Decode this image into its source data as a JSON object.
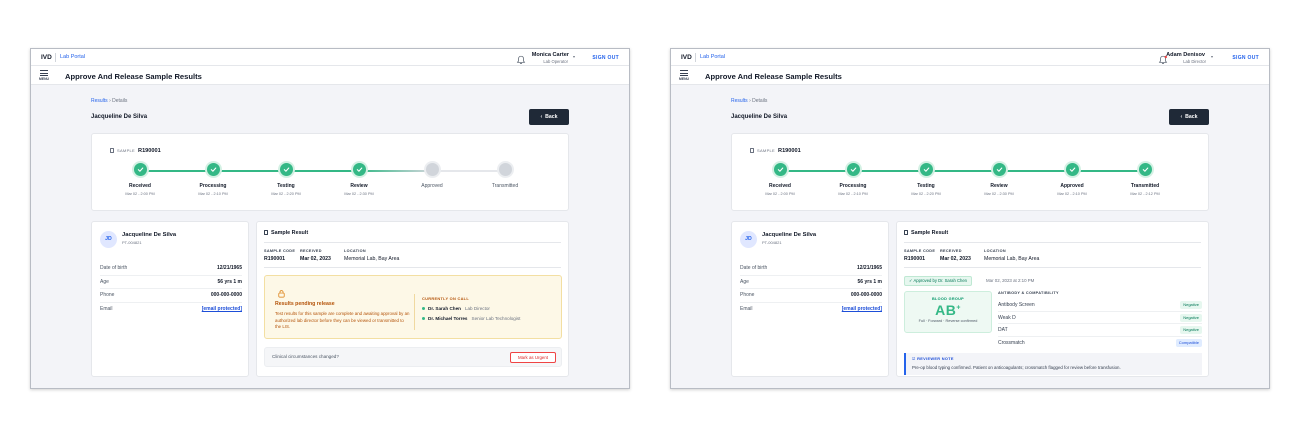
{
  "brand": "IVD",
  "portal": "Lab Portal",
  "sign_out": "SIGN OUT",
  "menu_label": "MENU",
  "page_title": "Approve And Release Sample Results",
  "breadcrumb": {
    "link": "Results",
    "sep": "›",
    "current": "Details"
  },
  "back_label": "Back",
  "patient": {
    "name": "Jacqueline De Silva",
    "initials": "JD",
    "id": "PT-004821",
    "rows": [
      {
        "label": "Date of birth",
        "value": "12/21/1965"
      },
      {
        "label": "Age",
        "value": "56 yrs 1 m"
      },
      {
        "label": "Phone",
        "value": "000-000-0000"
      },
      {
        "label": "Email",
        "value": "[email protected]"
      }
    ]
  },
  "sample": {
    "label": "SAMPLE",
    "code": "R190001"
  },
  "result": {
    "heading": "Sample Result",
    "meta": [
      {
        "label": "SAMPLE CODE",
        "value": "R190001"
      },
      {
        "label": "RECEIVED",
        "value": "Mar 02, 2023"
      },
      {
        "label": "LOCATION",
        "value": "Memorial Lab, Bay Area"
      }
    ]
  },
  "screens": [
    {
      "user": {
        "name": "Monica Carter",
        "role": "Lab Operator"
      },
      "steps": [
        {
          "label": "Received",
          "time": "Mar 02 - 2:00 PM",
          "done": true
        },
        {
          "label": "Processing",
          "time": "Mar 02 - 2:10 PM",
          "done": true
        },
        {
          "label": "Testing",
          "time": "Mar 02 - 2:20 PM",
          "done": true
        },
        {
          "label": "Review",
          "time": "Mar 02 - 2:30 PM",
          "done": true
        },
        {
          "label": "Approved",
          "time": "",
          "done": false
        },
        {
          "label": "Transmitted",
          "time": "",
          "done": false
        }
      ],
      "pending": {
        "title": "Results pending release",
        "text": "Test results for this sample are complete and awaiting approval by an authorized lab director before they can be viewed or transmitted to the LIS.",
        "oncall_label": "CURRENTLY ON CALL",
        "oncall": [
          {
            "name": "Dr. Sarah Chen",
            "role": "Lab Director"
          },
          {
            "name": "Dr. Michael Torres",
            "role": "Senior Lab Technologist"
          }
        ]
      },
      "clinical": {
        "question": "Clinical circumstances changed?",
        "button": "Mark as Urgent"
      }
    },
    {
      "user": {
        "name": "Adam Denisov",
        "role": "Lab Director"
      },
      "steps": [
        {
          "label": "Received",
          "time": "Mar 02 - 2:00 PM",
          "done": true
        },
        {
          "label": "Processing",
          "time": "Mar 02 - 2:10 PM",
          "done": true
        },
        {
          "label": "Testing",
          "time": "Mar 02 - 2:20 PM",
          "done": true
        },
        {
          "label": "Review",
          "time": "Mar 02 - 2:30 PM",
          "done": true
        },
        {
          "label": "Approved",
          "time": "Mar 02 - 2:10 PM",
          "done": true
        },
        {
          "label": "Transmitted",
          "time": "Mar 02 - 2:12 PM",
          "done": true
        }
      ],
      "approved": {
        "tag": "✓ Approved by Dr. Sarah Chen",
        "time": "Mar 02, 2023 at 2:10 PM"
      },
      "blood": {
        "label": "BLOOD GROUP",
        "value": "AB",
        "sign": "+",
        "desc": "Full · Forward · Reverse confirmed"
      },
      "antibody": {
        "label": "ANTIBODY & COMPATIBILITY",
        "rows": [
          {
            "name": "Antibody Screen",
            "badge": "Negative",
            "kind": "neg"
          },
          {
            "name": "Weak D",
            "badge": "Negative",
            "kind": "neg"
          },
          {
            "name": "DAT",
            "badge": "Negative",
            "kind": "neg"
          },
          {
            "name": "Crossmatch",
            "badge": "Compatible",
            "kind": "comp"
          }
        ]
      },
      "note": {
        "label": "REVIEWER NOTE",
        "text": "Pre-op blood typing confirmed. Patient on anticoagulants; crossmatch flagged for review before transfusion."
      }
    }
  ],
  "colors": {
    "accent": "#2563eb",
    "success": "#34b886",
    "warning": "#b45309",
    "dark": "#1f2937"
  }
}
